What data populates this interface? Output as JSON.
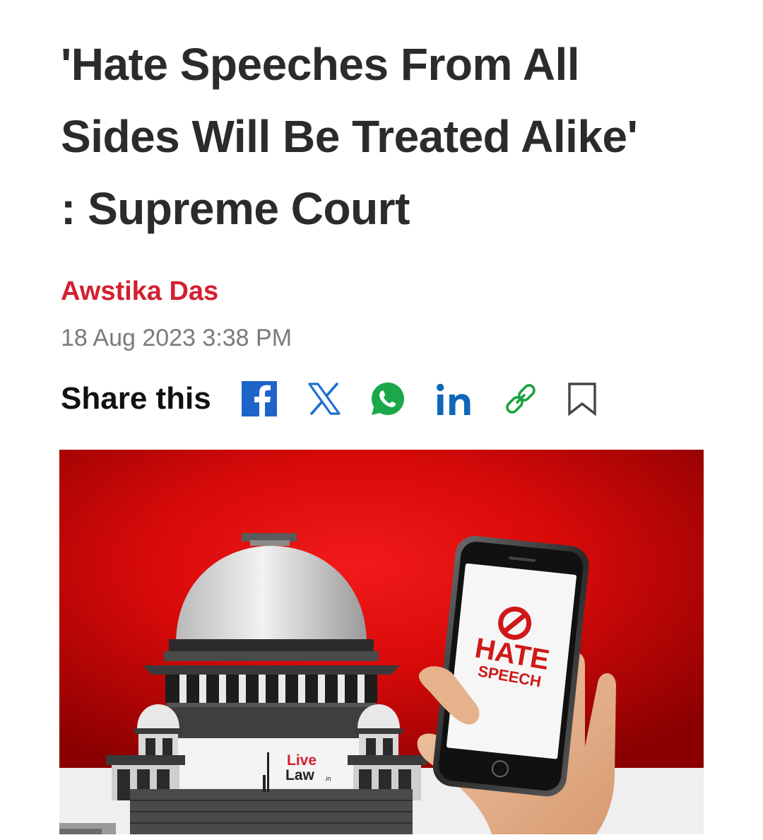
{
  "article": {
    "headline_lines": [
      "'Hate Speeches From All",
      "Sides Will Be Treated Alike'",
      ": Supreme Court"
    ],
    "author": "Awstika Das",
    "date": "18 Aug 2023 3:38 PM"
  },
  "share": {
    "label": "Share this",
    "icons": [
      "facebook-icon",
      "x-icon",
      "whatsapp-icon",
      "linkedin-icon",
      "link-icon",
      "bookmark-icon"
    ]
  },
  "hero_image": {
    "phone_hate": "HATE",
    "phone_speech": "SPEECH",
    "logo_live": "Live",
    "logo_law": "Law",
    "logo_suffix": ".in"
  },
  "colors": {
    "headline": "#2b2b2b",
    "author": "#d32030",
    "date": "#7a7a7a",
    "facebook": "#1e64c8",
    "x": "#1e6fd0",
    "whatsapp": "#1aa84a",
    "linkedin": "#1066b8",
    "link": "#19a33e",
    "bookmark": "#444444"
  }
}
